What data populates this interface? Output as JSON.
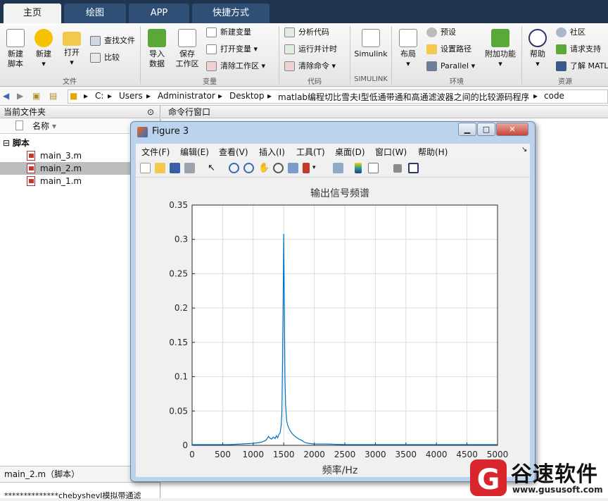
{
  "tabs": [
    "主页",
    "绘图",
    "APP",
    "快捷方式"
  ],
  "ribbon": {
    "file": {
      "new_script": "新建\n脚本",
      "new": "新建",
      "open": "打开",
      "find_files": "查找文件",
      "compare": "比较",
      "section": "文件"
    },
    "variable": {
      "import": "导入\n数据",
      "save_ws": "保存\n工作区",
      "new_var": "新建变量",
      "open_var": "打开变量",
      "clear_ws": "清除工作区",
      "section": "变量"
    },
    "code": {
      "analyze": "分析代码",
      "run_time": "运行并计时",
      "clear_cmd": "清除命令",
      "section": "代码"
    },
    "simulink": {
      "label": "Simulink",
      "section": "SIMULINK"
    },
    "env": {
      "layout": "布局",
      "prefs": "预设",
      "set_path": "设置路径",
      "parallel": "Parallel",
      "addons": "附加功能",
      "section": "环境"
    },
    "res": {
      "help": "帮助",
      "community": "社区",
      "support": "请求支持",
      "learn": "了解 MATL",
      "section": "资源"
    }
  },
  "path": [
    "C:",
    "Users",
    "Administrator",
    "Desktop",
    "matlab编程切比雪夫I型低通带通和高通滤波器之间的比较源码程序",
    "code"
  ],
  "left_panel": {
    "title": "当前文件夹",
    "col_name": "名称",
    "folder": "脚本",
    "files": [
      "main_3.m",
      "main_2.m",
      "main_1.m"
    ],
    "detail_title": "main_2.m（脚本）",
    "detail_text": "**************chebyshevI模拟带通滤"
  },
  "cmd_title": "命令行窗口",
  "figure": {
    "title": "Figure 3",
    "menu": [
      "文件(F)",
      "编辑(E)",
      "查看(V)",
      "插入(I)",
      "工具(T)",
      "桌面(D)",
      "窗口(W)",
      "帮助(H)"
    ]
  },
  "chart_data": {
    "type": "line",
    "title": "输出信号频谱",
    "xlabel": "频率/Hz",
    "ylabel": "",
    "xlim": [
      0,
      5000
    ],
    "ylim": [
      0,
      0.35
    ],
    "xticks": [
      0,
      500,
      1000,
      1500,
      2000,
      2500,
      3000,
      3500,
      4000,
      4500,
      5000
    ],
    "yticks": [
      0,
      0.05,
      0.1,
      0.15,
      0.2,
      0.25,
      0.3,
      0.35
    ],
    "grid": true,
    "color": "#0072bd",
    "series": [
      {
        "x": [
          0,
          200,
          400,
          600,
          800,
          1000,
          1100,
          1150,
          1200,
          1230,
          1250,
          1270,
          1300,
          1330,
          1360,
          1380,
          1400,
          1420,
          1440,
          1460,
          1470,
          1480,
          1490,
          1500,
          1510,
          1520,
          1530,
          1540,
          1550,
          1570,
          1600,
          1630,
          1660,
          1700,
          1750,
          1800,
          1850,
          1900,
          2000,
          2200,
          2500,
          3000,
          3500,
          4000,
          4500,
          5000
        ],
        "y": [
          0.001,
          0.001,
          0.001,
          0.001,
          0.002,
          0.003,
          0.004,
          0.005,
          0.007,
          0.01,
          0.013,
          0.011,
          0.009,
          0.012,
          0.01,
          0.014,
          0.011,
          0.016,
          0.018,
          0.03,
          0.05,
          0.12,
          0.2,
          0.308,
          0.2,
          0.1,
          0.06,
          0.045,
          0.035,
          0.028,
          0.022,
          0.018,
          0.015,
          0.012,
          0.009,
          0.007,
          0.004,
          0.003,
          0.002,
          0.002,
          0.001,
          0.001,
          0.001,
          0.001,
          0.001,
          0.001
        ]
      }
    ]
  },
  "watermark": {
    "name": "谷速软件",
    "url": "www.gususoft.com"
  }
}
